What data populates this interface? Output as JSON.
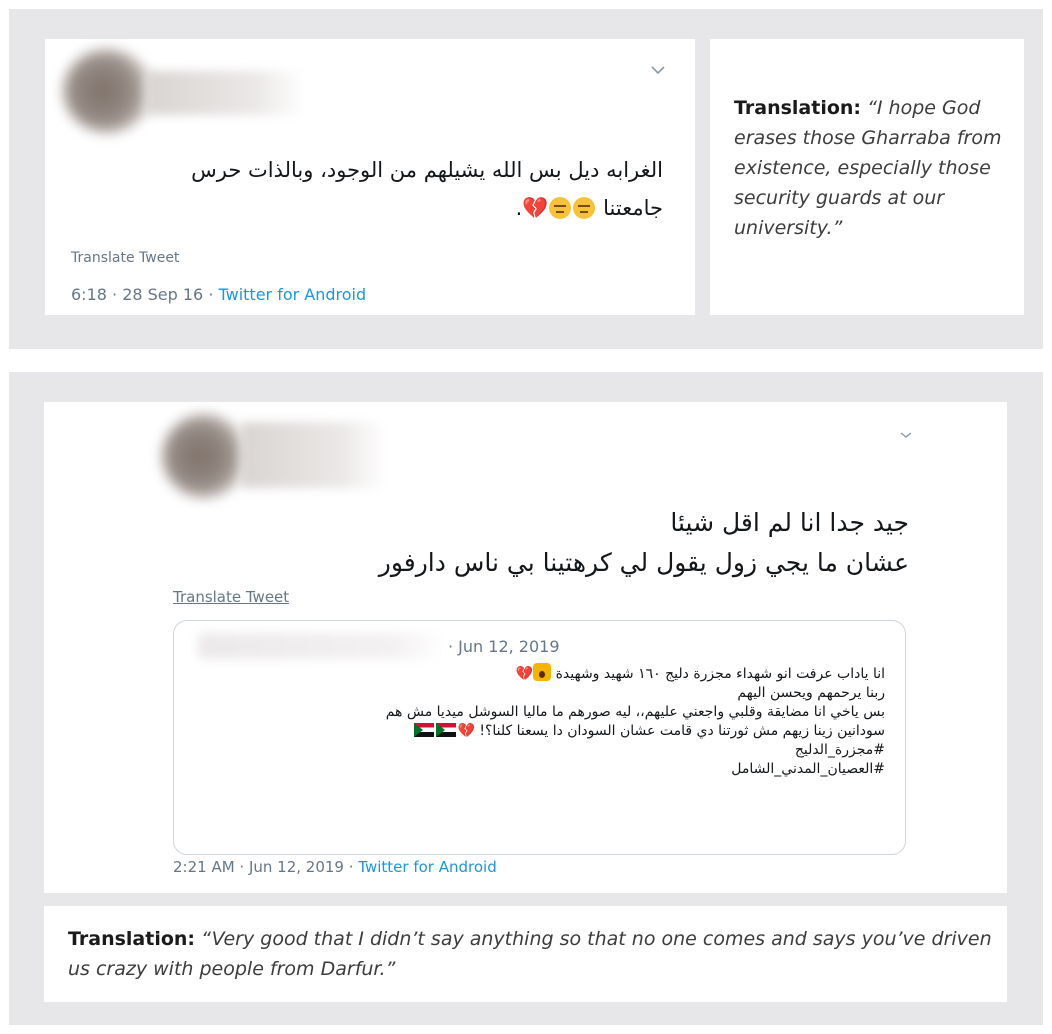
{
  "tweet1": {
    "text_line1": "الغرابه ديل بس الله يشيلهم من الوجود، وبالذات حرس",
    "text_line2": "جامعتنا",
    "text_end": ".",
    "translate_label": "Translate Tweet",
    "timestamp": "6:18 · 28 Sep 16 · ",
    "source": "Twitter for Android",
    "emoji": [
      "expressionless-face",
      "expressionless-face",
      "broken-heart"
    ]
  },
  "translation1": {
    "label": "Translation:",
    "text": "“I hope God erases those Gharraba from existence, especially those security guards at our university.”"
  },
  "tweet2": {
    "text_line1": "جيد جدا انا لم اقل شيئا",
    "text_line2": "عشان ما يجي زول يقول لي كرهتينا بي ناس دارفور",
    "translate_label": "Translate Tweet",
    "timestamp": "2:21 AM · Jun 12, 2019 · ",
    "source": "Twitter for Android",
    "quoted": {
      "date": "· Jun 12, 2019",
      "lines": [
        "انا ياداب عرفت انو شهداء مجزرة دليج ١٦٠ شهيد وشهيدة",
        "ربنا يرحمهم ويحسن اليهم",
        "بس ياخي انا مضايقة وقلبي واجعني عليهم،، ليه صورهم ما ماليا السوشل ميديا مش هم",
        "سودانين زينا زيهم مش ثورتنا دي قامت عشان السودان دا يسعنا كلنا؟!",
        "#مجزرة_الدليج",
        "#العصيان_المدني_الشامل"
      ]
    }
  },
  "translation2": {
    "label": "Translation:",
    "text": "“Very good that I didn’t say anything so that no one comes and says you’ve driven us crazy with people from Darfur.”"
  },
  "colors": {
    "panel_bg": "#e7e7e9",
    "link": "#1b95e0",
    "meta": "#657786",
    "heart": "#e0245e"
  }
}
